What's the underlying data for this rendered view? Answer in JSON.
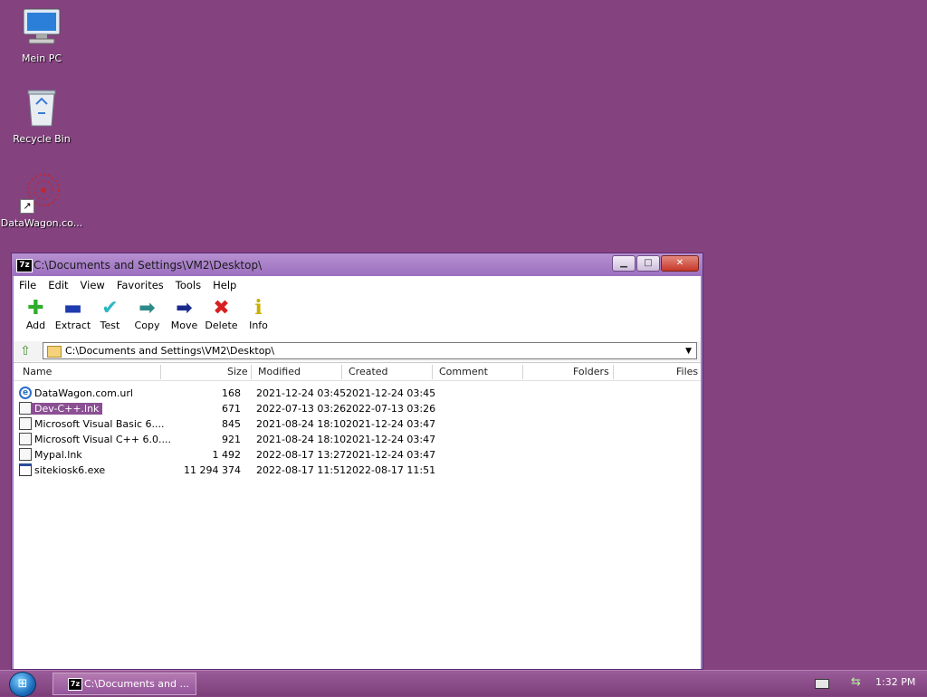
{
  "desktop": {
    "icons": [
      {
        "label": "Mein PC",
        "icon": "computer-icon"
      },
      {
        "label": "Recycle Bin",
        "icon": "recycle-bin-icon"
      },
      {
        "label": "DataWagon.co...",
        "icon": "datawagon-icon"
      }
    ]
  },
  "window": {
    "title": "C:\\Documents and Settings\\VM2\\Desktop\\",
    "app_icon_text": "7z",
    "menu": [
      "File",
      "Edit",
      "View",
      "Favorites",
      "Tools",
      "Help"
    ],
    "toolbar": [
      {
        "label": "Add",
        "icon": "add-icon",
        "glyph": "✚",
        "color": "#2fae2b"
      },
      {
        "label": "Extract",
        "icon": "extract-icon",
        "glyph": "▬",
        "color": "#1f3bb0"
      },
      {
        "label": "Test",
        "icon": "test-icon",
        "glyph": "✔",
        "color": "#2cb8c2"
      },
      {
        "label": "Copy",
        "icon": "copy-icon",
        "glyph": "➡",
        "color": "#2d8a8a"
      },
      {
        "label": "Move",
        "icon": "move-icon",
        "glyph": "➡",
        "color": "#1a2a8c"
      },
      {
        "label": "Delete",
        "icon": "delete-icon",
        "glyph": "✖",
        "color": "#d81f1f"
      },
      {
        "label": "Info",
        "icon": "info-icon",
        "glyph": "i",
        "color": "#c9b000"
      }
    ],
    "address": "C:\\Documents and Settings\\VM2\\Desktop\\",
    "columns": {
      "name": "Name",
      "size": "Size",
      "modified": "Modified",
      "created": "Created",
      "comment": "Comment",
      "folders": "Folders",
      "files": "Files"
    },
    "files": [
      {
        "name": "DataWagon.com.url",
        "size": "168",
        "modified": "2021-12-24 03:45",
        "created": "2021-12-24 03:45",
        "type": "url"
      },
      {
        "name": "Dev-C++.lnk",
        "size": "671",
        "modified": "2022-07-13 03:26",
        "created": "2022-07-13 03:26",
        "type": "lnk",
        "selected": true
      },
      {
        "name": "Microsoft Visual Basic 6....",
        "size": "845",
        "modified": "2021-08-24 18:10",
        "created": "2021-12-24 03:47",
        "type": "lnk"
      },
      {
        "name": "Microsoft Visual C++ 6.0....",
        "size": "921",
        "modified": "2021-08-24 18:10",
        "created": "2021-12-24 03:47",
        "type": "lnk"
      },
      {
        "name": "Mypal.lnk",
        "size": "1 492",
        "modified": "2022-08-17 13:27",
        "created": "2021-12-24 03:47",
        "type": "lnk"
      },
      {
        "name": "sitekiosk6.exe",
        "size": "11 294 374",
        "modified": "2022-08-17 11:51",
        "created": "2022-08-17 11:51",
        "type": "exe"
      }
    ]
  },
  "taskbar": {
    "task_label": "C:\\Documents and ...",
    "task_icon_text": "7z",
    "clock": "1:32 PM"
  },
  "colors": {
    "desktop": "#84427f",
    "selection": "#8b4f93"
  }
}
